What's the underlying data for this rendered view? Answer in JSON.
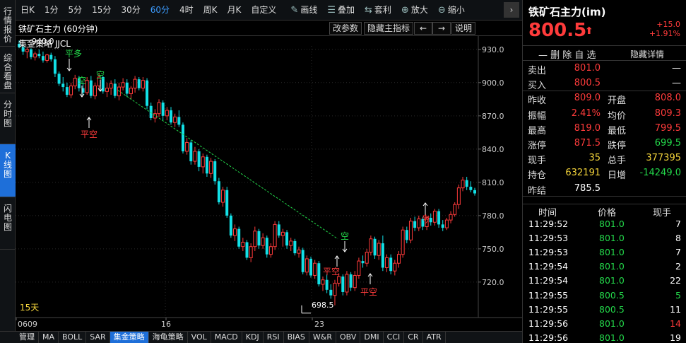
{
  "left_tabs": [
    "行情报价",
    "综合看盘",
    "分时图",
    "K线图",
    "闪电图"
  ],
  "toolbar": {
    "periods": [
      "日K",
      "1分",
      "5分",
      "15分",
      "30分",
      "60分",
      "4时",
      "周K",
      "月K",
      "自定义"
    ],
    "active_period": "60分",
    "tools": [
      {
        "label": "画线",
        "icon": "pencil-icon",
        "glyph": "✎"
      },
      {
        "label": "叠加",
        "icon": "stack-icon",
        "glyph": "☰"
      },
      {
        "label": "套利",
        "icon": "arbitrage-icon",
        "glyph": "⇆"
      },
      {
        "label": "放大",
        "icon": "zoom-in-icon",
        "glyph": "⊕"
      },
      {
        "label": "缩小",
        "icon": "zoom-out-icon",
        "glyph": "⊖"
      }
    ],
    "next_glyph": "›"
  },
  "chart": {
    "title": "铁矿石主力 (60分钟)",
    "buttons": {
      "params": "改参数",
      "hide_indicator": "隐藏主指标",
      "left": "←",
      "right": "→",
      "help": "说明"
    },
    "strategy_label": "集金策略 JJCL",
    "max_label": "940.0",
    "min_label": "698.5",
    "period_label": "15天",
    "x_labels": [
      "0609",
      "16",
      "23"
    ],
    "signals": [
      "平多",
      "空",
      "空",
      "平空",
      "空",
      "平空",
      "平空",
      "多"
    ]
  },
  "chart_data": {
    "type": "candlestick",
    "y_ticks": [
      930,
      900,
      870,
      840,
      810,
      780,
      750,
      720
    ],
    "ylim": [
      688,
      942
    ],
    "colors": {
      "up": "#ff3b3b",
      "down": "#12e0e6",
      "trend": "#23d84a"
    },
    "bars": [
      [
        935,
        938,
        931,
        932
      ],
      [
        932,
        934,
        925,
        928
      ],
      [
        928,
        932,
        922,
        930
      ],
      [
        930,
        931,
        921,
        923
      ],
      [
        923,
        928,
        920,
        926
      ],
      [
        926,
        930,
        922,
        924
      ],
      [
        924,
        928,
        918,
        920
      ],
      [
        920,
        926,
        918,
        925
      ],
      [
        925,
        927,
        919,
        921
      ],
      [
        921,
        924,
        905,
        908
      ],
      [
        908,
        910,
        897,
        899
      ],
      [
        899,
        905,
        892,
        896
      ],
      [
        896,
        900,
        887,
        889
      ],
      [
        889,
        900,
        886,
        897
      ],
      [
        897,
        907,
        894,
        904
      ],
      [
        904,
        906,
        892,
        895
      ],
      [
        895,
        900,
        889,
        891
      ],
      [
        891,
        905,
        889,
        902
      ],
      [
        902,
        906,
        886,
        888
      ],
      [
        888,
        900,
        885,
        897
      ],
      [
        897,
        908,
        893,
        905
      ],
      [
        905,
        906,
        890,
        892
      ],
      [
        892,
        900,
        887,
        895
      ],
      [
        895,
        902,
        889,
        899
      ],
      [
        899,
        903,
        886,
        888
      ],
      [
        888,
        900,
        884,
        896
      ],
      [
        896,
        904,
        893,
        900
      ],
      [
        900,
        903,
        887,
        890
      ],
      [
        890,
        897,
        885,
        895
      ],
      [
        895,
        906,
        891,
        903
      ],
      [
        903,
        905,
        893,
        895
      ],
      [
        895,
        905,
        892,
        902
      ],
      [
        902,
        904,
        876,
        879
      ],
      [
        879,
        882,
        866,
        868
      ],
      [
        868,
        876,
        864,
        872
      ],
      [
        872,
        885,
        869,
        882
      ],
      [
        882,
        884,
        866,
        870
      ],
      [
        870,
        878,
        866,
        875
      ],
      [
        875,
        878,
        862,
        864
      ],
      [
        864,
        872,
        860,
        869
      ],
      [
        869,
        875,
        860,
        862
      ],
      [
        862,
        864,
        836,
        838
      ],
      [
        838,
        850,
        835,
        846
      ],
      [
        846,
        848,
        826,
        829
      ],
      [
        829,
        842,
        826,
        838
      ],
      [
        838,
        840,
        820,
        824
      ],
      [
        824,
        836,
        818,
        833
      ],
      [
        833,
        835,
        815,
        818
      ],
      [
        818,
        832,
        814,
        829
      ],
      [
        829,
        831,
        808,
        811
      ],
      [
        811,
        814,
        790,
        792
      ],
      [
        792,
        806,
        788,
        803
      ],
      [
        803,
        806,
        778,
        780
      ],
      [
        780,
        782,
        760,
        762
      ],
      [
        762,
        772,
        757,
        768
      ],
      [
        768,
        770,
        750,
        752
      ],
      [
        752,
        760,
        748,
        756
      ],
      [
        756,
        758,
        740,
        742
      ],
      [
        742,
        755,
        738,
        752
      ],
      [
        752,
        770,
        748,
        766
      ],
      [
        766,
        768,
        750,
        753
      ],
      [
        753,
        764,
        750,
        760
      ],
      [
        760,
        762,
        742,
        745
      ],
      [
        745,
        755,
        742,
        752
      ],
      [
        752,
        775,
        749,
        772
      ],
      [
        772,
        775,
        760,
        762
      ],
      [
        762,
        768,
        752,
        765
      ],
      [
        765,
        767,
        750,
        753
      ],
      [
        753,
        760,
        748,
        757
      ],
      [
        757,
        759,
        744,
        746
      ],
      [
        746,
        752,
        742,
        749
      ],
      [
        749,
        751,
        727,
        729
      ],
      [
        729,
        744,
        726,
        741
      ],
      [
        741,
        743,
        724,
        726
      ],
      [
        726,
        740,
        723,
        737
      ],
      [
        737,
        739,
        716,
        718
      ],
      [
        718,
        725,
        712,
        722
      ],
      [
        722,
        727,
        710,
        713
      ],
      [
        713,
        718,
        705,
        708
      ],
      [
        708,
        722,
        699,
        719
      ],
      [
        719,
        728,
        716,
        725
      ],
      [
        725,
        727,
        708,
        711
      ],
      [
        711,
        730,
        708,
        727
      ],
      [
        727,
        729,
        712,
        715
      ],
      [
        715,
        730,
        712,
        726
      ],
      [
        726,
        742,
        723,
        739
      ],
      [
        739,
        744,
        733,
        737
      ],
      [
        737,
        750,
        734,
        747
      ],
      [
        747,
        762,
        744,
        759
      ],
      [
        759,
        761,
        741,
        744
      ],
      [
        744,
        758,
        740,
        755
      ],
      [
        755,
        762,
        730,
        733
      ],
      [
        733,
        745,
        729,
        742
      ],
      [
        742,
        745,
        727,
        730
      ],
      [
        730,
        740,
        726,
        737
      ],
      [
        737,
        748,
        733,
        745
      ],
      [
        745,
        770,
        742,
        767
      ],
      [
        767,
        770,
        755,
        758
      ],
      [
        758,
        778,
        755,
        775
      ],
      [
        775,
        779,
        766,
        769
      ],
      [
        769,
        780,
        766,
        777
      ],
      [
        777,
        779,
        767,
        770
      ],
      [
        770,
        780,
        767,
        778
      ],
      [
        778,
        782,
        771,
        774
      ],
      [
        774,
        786,
        771,
        784
      ],
      [
        784,
        786,
        769,
        772
      ],
      [
        772,
        776,
        766,
        769
      ],
      [
        769,
        778,
        767,
        776
      ],
      [
        776,
        784,
        773,
        781
      ],
      [
        781,
        792,
        779,
        790
      ],
      [
        790,
        808,
        786,
        805
      ],
      [
        805,
        815,
        802,
        812
      ],
      [
        812,
        815,
        803,
        806
      ],
      [
        806,
        811,
        801,
        803
      ],
      [
        803,
        805,
        798,
        800
      ]
    ]
  },
  "quote": {
    "name": "铁矿石主力(im)",
    "price": "800.5",
    "arrow": "⬆",
    "change": "+15.0",
    "change_pct": "+1.91%",
    "delete_label": "删 除 自 选",
    "delete_prefix": "—",
    "hide_label": "隐藏详情",
    "rows": [
      {
        "l1": "卖出",
        "v1": "801.0",
        "c1": "red",
        "l2": "",
        "v2": "—",
        "c2": "white"
      },
      {
        "l1": "买入",
        "v1": "800.5",
        "c1": "red",
        "l2": "",
        "v2": "—",
        "c2": "white"
      },
      {
        "l1": "昨收",
        "v1": "809.0",
        "c1": "red",
        "l2": "开盘",
        "v2": "808.0",
        "c2": "red"
      },
      {
        "l1": "振幅",
        "v1": "2.41%",
        "c1": "red",
        "l2": "均价",
        "v2": "809.3",
        "c2": "red"
      },
      {
        "l1": "最高",
        "v1": "819.0",
        "c1": "red",
        "l2": "最低",
        "v2": "799.5",
        "c2": "red"
      },
      {
        "l1": "涨停",
        "v1": "871.5",
        "c1": "red",
        "l2": "跌停",
        "v2": "699.5",
        "c2": "green"
      },
      {
        "l1": "现手",
        "v1": "35",
        "c1": "yellow",
        "l2": "总手",
        "v2": "377395",
        "c2": "yellow"
      },
      {
        "l1": "持仓",
        "v1": "632191",
        "c1": "yellow",
        "l2": "日增",
        "v2": "-14249.0",
        "c2": "green"
      },
      {
        "l1": "昨结",
        "v1": "785.5",
        "c1": "white",
        "l2": "",
        "v2": "",
        "c2": "white"
      }
    ],
    "trades_header": {
      "time": "时间",
      "price": "价格",
      "vol": "现手"
    },
    "trades": [
      {
        "time": "11:29:52",
        "price": "801.0",
        "vol": "7",
        "vc": "white"
      },
      {
        "time": "11:29:53",
        "price": "801.0",
        "vol": "8",
        "vc": "white"
      },
      {
        "time": "11:29:53",
        "price": "801.0",
        "vol": "7",
        "vc": "white"
      },
      {
        "time": "11:29:54",
        "price": "801.0",
        "vol": "2",
        "vc": "white"
      },
      {
        "time": "11:29:54",
        "price": "801.0",
        "vol": "22",
        "vc": "white"
      },
      {
        "time": "11:29:55",
        "price": "800.5",
        "vol": "5",
        "vc": "green"
      },
      {
        "time": "11:29:55",
        "price": "800.5",
        "vol": "11",
        "vc": "white"
      },
      {
        "time": "11:29:56",
        "price": "801.0",
        "vol": "14",
        "vc": "red"
      },
      {
        "time": "11:29:56",
        "price": "801.0",
        "vol": "19",
        "vc": "white"
      }
    ]
  },
  "bottom_tabs": [
    "管理",
    "MA",
    "BOLL",
    "SAR",
    "集金策略",
    "海龟策略",
    "VOL",
    "MACD",
    "KDJ",
    "RSI",
    "BIAS",
    "W&R",
    "OBV",
    "DMI",
    "CCI",
    "CR",
    "ATR"
  ],
  "bottom_active": "集金策略"
}
